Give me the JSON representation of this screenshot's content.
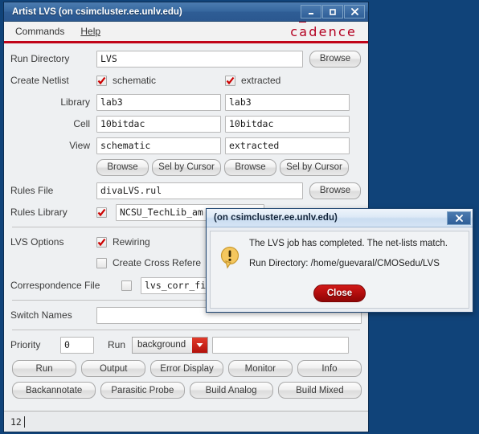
{
  "desktop": {
    "background_color": "#104379"
  },
  "window": {
    "title": "Artist LVS (on csimcluster.ee.unlv.edu)",
    "controls": {
      "minimize": "minimize-icon",
      "maximize": "maximize-icon",
      "close": "close-icon"
    },
    "menubar": {
      "items": [
        "Commands",
        "Help"
      ],
      "brand": "cadence",
      "accent_color": "#c00418"
    },
    "statusbar": {
      "text": "12"
    }
  },
  "form": {
    "run_directory": {
      "label": "Run Directory",
      "value": "LVS",
      "browse_label": "Browse"
    },
    "create_netlist": {
      "label": "Create Netlist",
      "schematic": {
        "label": "schematic",
        "checked": true
      },
      "extracted": {
        "label": "extracted",
        "checked": true
      }
    },
    "library": {
      "label": "Library",
      "schematic_value": "lab3",
      "extracted_value": "lab3"
    },
    "cell": {
      "label": "Cell",
      "schematic_value": "10bitdac",
      "extracted_value": "10bitdac"
    },
    "view": {
      "label": "View",
      "schematic_value": "schematic",
      "extracted_value": "extracted"
    },
    "netlist_buttons": {
      "browse_label": "Browse",
      "sel_by_cursor_label": "Sel by Cursor"
    },
    "rules_file": {
      "label": "Rules File",
      "value": "divaLVS.rul",
      "browse_label": "Browse"
    },
    "rules_library": {
      "label": "Rules Library",
      "checked": true,
      "value": "NCSU_TechLib_am"
    },
    "lvs_options": {
      "label": "LVS Options",
      "rewiring": {
        "label": "Rewiring",
        "checked": true
      },
      "create_cross_reference": {
        "label": "Create Cross Refere",
        "checked": false
      }
    },
    "correspondence_file": {
      "label": "Correspondence File",
      "checked": false,
      "value": "lvs_corr_fi"
    },
    "switch_names": {
      "label": "Switch Names",
      "value": ""
    },
    "priority": {
      "label": "Priority",
      "value": "0"
    },
    "run_mode": {
      "label": "Run",
      "value": "background",
      "host_value": ""
    }
  },
  "action_buttons": {
    "row1": [
      "Run",
      "Output",
      "Error Display",
      "Monitor",
      "Info"
    ],
    "row2": [
      "Backannotate",
      "Parasitic Probe",
      "Build Analog",
      "Build Mixed"
    ]
  },
  "dialog": {
    "title": "(on csimcluster.ee.unlv.edu)",
    "icon": "warning-icon",
    "message_line1": "The LVS job has completed. The net-lists match.",
    "message_line2": "Run Directory: /home/guevaral/CMOSedu/LVS",
    "close_label": "Close",
    "close_color": "#b20d0d"
  }
}
